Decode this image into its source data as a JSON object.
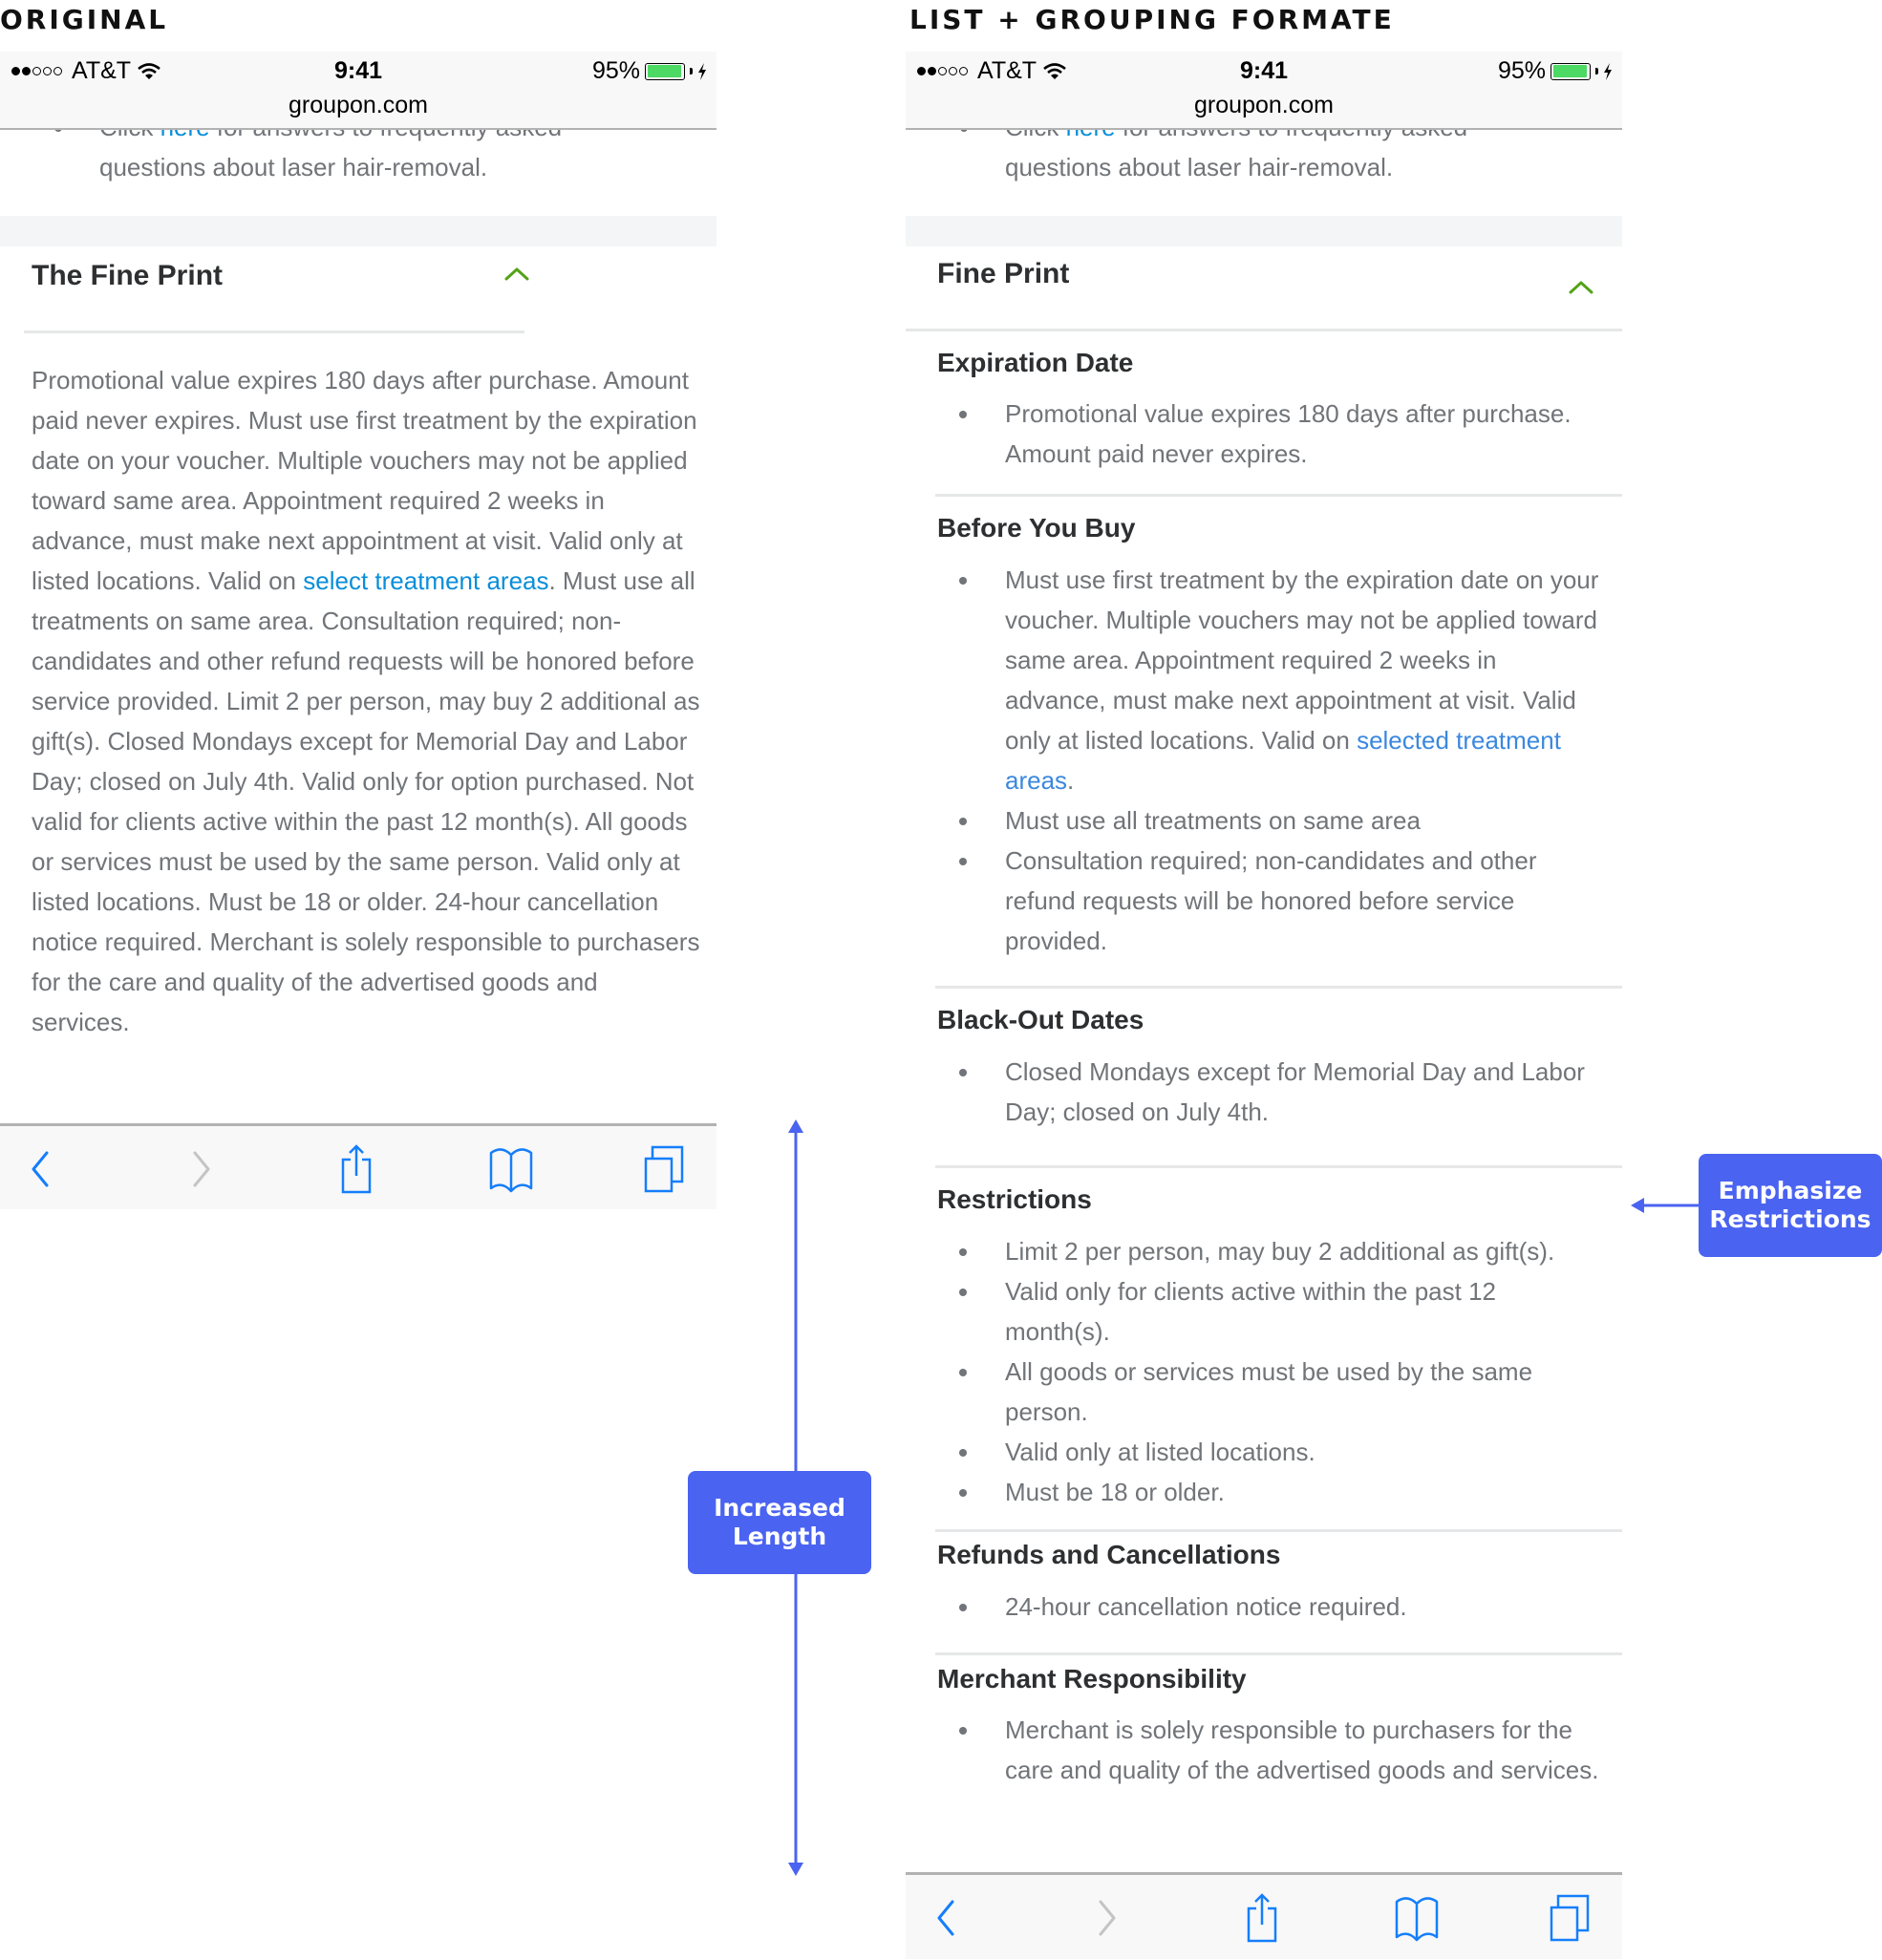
{
  "labels": {
    "left": "ORIGINAL",
    "right": "LIST + GROUPING FORMATE"
  },
  "status_bar": {
    "signal_dots_filled": 2,
    "signal_dots_total": 5,
    "carrier": "AT&T",
    "wifi_icon": "wifi-icon",
    "time": "9:41",
    "battery_percent_text": "95%",
    "battery_level": 0.95,
    "charging_icon": "bolt-icon",
    "url": "groupon.com",
    "battery_color": "#4cd964"
  },
  "scrolled_item": {
    "prefix": "Click ",
    "link": "here",
    "suffix": " for answers to frequently asked",
    "line2": "questions about laser hair-removal."
  },
  "original": {
    "title": "The Fine Print",
    "chevron_icon": "chevron-up-icon",
    "body_before_link": "Promotional value expires 180 days after purchase. Amount paid never expires. Must use first treatment by the expiration date on your voucher. Multiple vouchers may not be applied toward same area. Appointment required 2 weeks in advance, must make next appointment at visit. Valid only at listed locations. Valid on ",
    "body_link": "select treatment areas",
    "body_after_link": ". Must use all treatments on same area. Consultation required; non-candidates and other refund requests will be honored before service provided. Limit 2 per person, may buy 2 additional as gift(s). Closed Mondays except for Memorial Day and Labor Day; closed on July 4th. Valid only for option purchased. Not valid for clients active within the past 12 month(s). All goods or services must be used by the same person. Valid only at listed locations. Must be 18 or older. 24-hour cancellation notice required. Merchant is solely responsible to purchasers for the care and quality of the advertised goods and services."
  },
  "grouped": {
    "title": "Fine Print",
    "chevron_icon": "chevron-up-icon",
    "sections": [
      {
        "heading": "Expiration Date",
        "items": [
          "Promotional value expires 180 days after purchase. Amount paid never expires."
        ]
      },
      {
        "heading": "Before You Buy",
        "items": [
          "Must use first treatment by the expiration date on your voucher. Multiple vouchers may not be applied toward same area. Appointment required 2 weeks in advance, must make next appointment at visit. Valid only at listed locations. Valid on ",
          "Must use all treatments on same area",
          "Consultation required; non-candidates and other refund requests will be honored before service provided."
        ],
        "item0_link": "selected treatment areas",
        "item0_after": "."
      },
      {
        "heading": "Black-Out Dates",
        "items": [
          "Closed Mondays except for Memorial Day and Labor Day; closed on July 4th."
        ]
      },
      {
        "heading": "Restrictions",
        "items": [
          "Limit 2 per person, may buy 2 additional as gift(s).",
          "Valid only for clients active within the past 12 month(s).",
          "All goods or services must be used by the same person.",
          "Valid only at listed locations.",
          "Must be 18 or older."
        ]
      },
      {
        "heading": "Refunds and Cancellations",
        "items": [
          "24-hour cancellation notice required."
        ]
      },
      {
        "heading": "Merchant Responsibility",
        "items": [
          "Merchant is solely responsible to purchasers for the care and quality of the advertised goods and services."
        ]
      }
    ]
  },
  "toolbar": {
    "buttons": [
      {
        "icon": "back-chevron-icon",
        "enabled": true
      },
      {
        "icon": "forward-chevron-icon",
        "enabled": false
      },
      {
        "icon": "share-icon",
        "enabled": true
      },
      {
        "icon": "bookmarks-icon",
        "enabled": true
      },
      {
        "icon": "tabs-icon",
        "enabled": true
      }
    ],
    "accent_color": "#157efb",
    "disabled_color": "#c4c4c4"
  },
  "annotations": {
    "increased_length": "Increased Length",
    "emphasize_restrictions": "Emphasize Restrictions",
    "color": "#4a63f0"
  },
  "colors": {
    "chevron_green": "#53a318",
    "link_blue": "#0a8ed9",
    "body_gray": "#717478",
    "heading_dark": "#2d2f31"
  }
}
